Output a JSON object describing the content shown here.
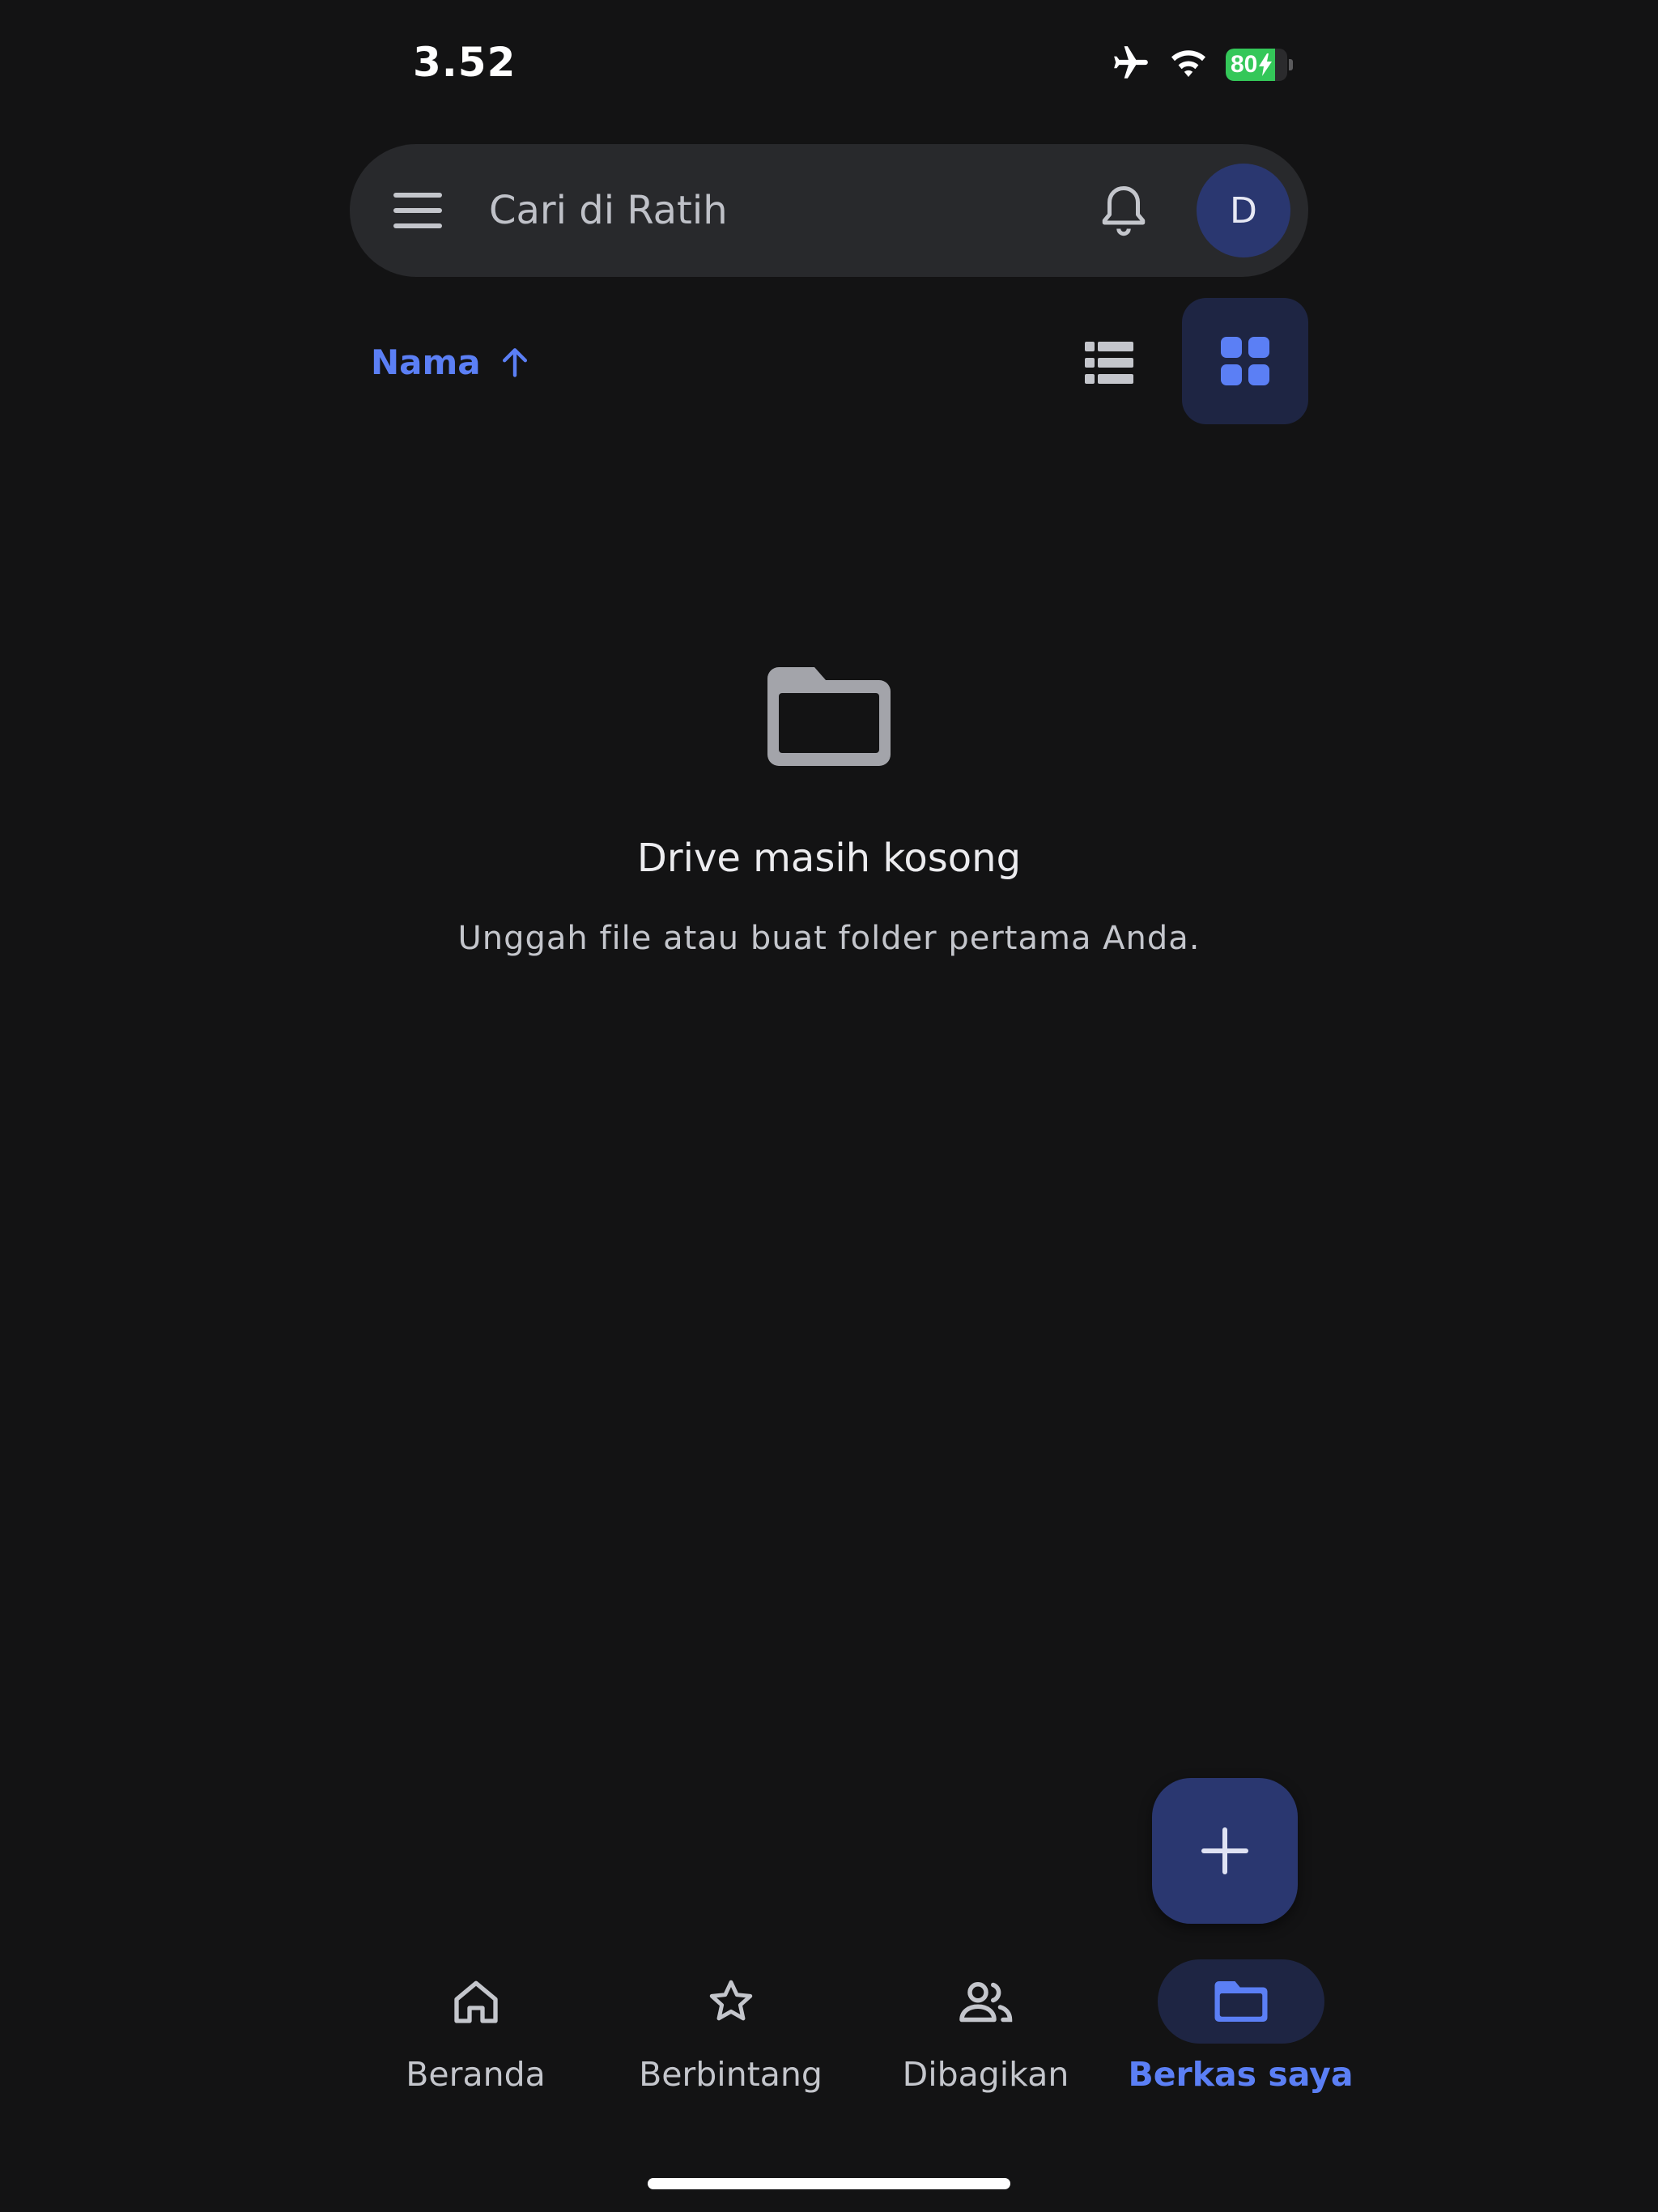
{
  "status_bar": {
    "time": "3.52",
    "battery": {
      "level": 80,
      "label": "80",
      "charging": true
    },
    "icons": [
      "airplane-icon",
      "wifi-icon",
      "battery-icon"
    ]
  },
  "search": {
    "placeholder": "Cari di Ratih",
    "avatar_initial": "D"
  },
  "sort": {
    "label": "Nama",
    "direction": "ascending"
  },
  "view_toggle": {
    "selected": "grid"
  },
  "empty_state": {
    "title": "Drive masih kosong",
    "subtitle": "Unggah file atau buat folder pertama Anda."
  },
  "bottom_nav": {
    "items": [
      {
        "label": "Beranda",
        "icon": "home-icon",
        "active": false
      },
      {
        "label": "Berbintang",
        "icon": "star-icon",
        "active": false
      },
      {
        "label": "Dibagikan",
        "icon": "people-icon",
        "active": false
      },
      {
        "label": "Berkas saya",
        "icon": "folder-icon",
        "active": true
      }
    ]
  },
  "colors": {
    "background": "#131314",
    "surface": "#28292c",
    "accent": "#5b7ff5",
    "accent_container": "#1e2543",
    "fab": "#2a3770",
    "battery_fill": "#34c759"
  }
}
